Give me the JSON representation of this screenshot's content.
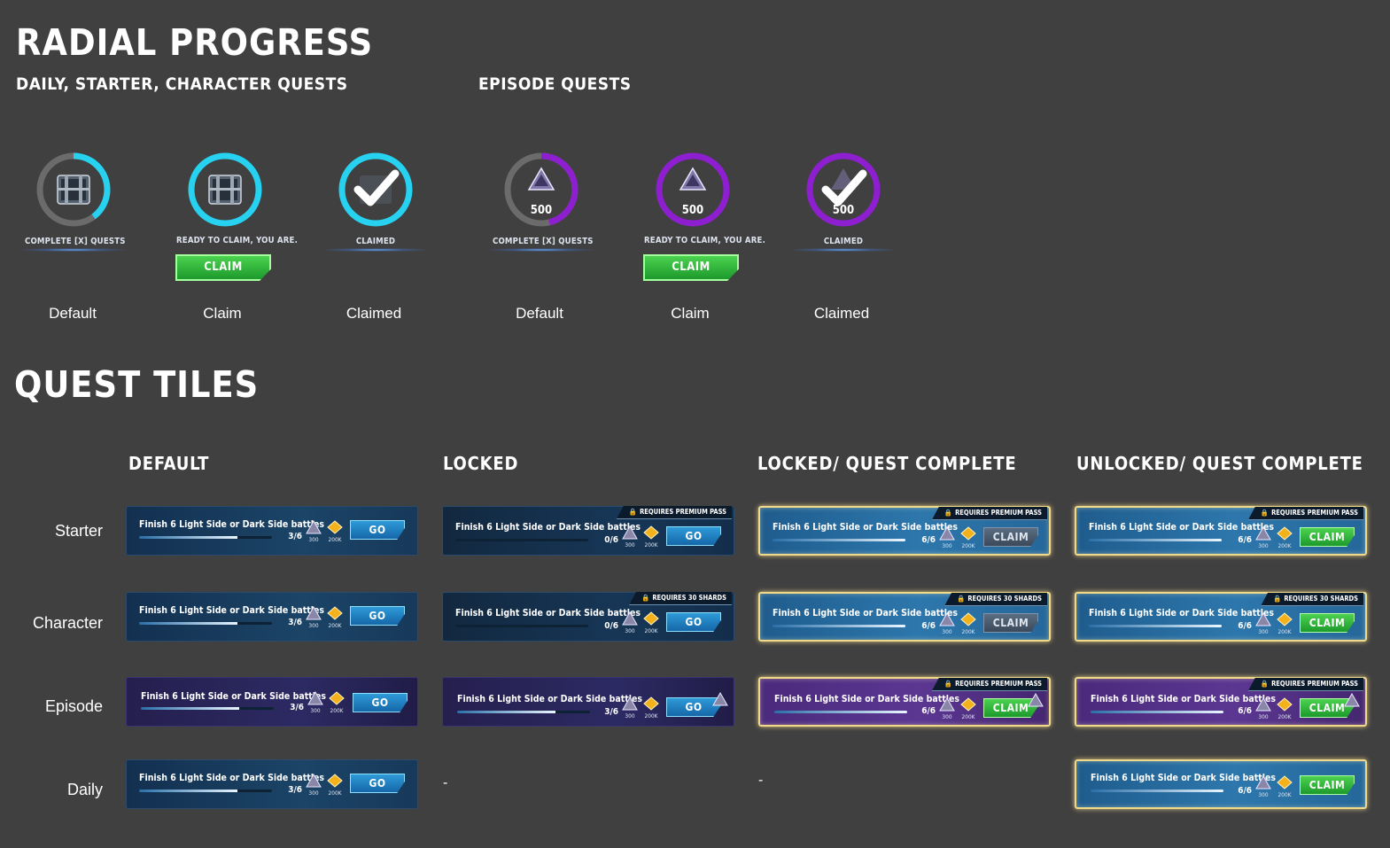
{
  "headings": {
    "radial_title": "RADIAL PROGRESS",
    "radial_left_sub": "DAILY, STARTER, CHARACTER QUESTS",
    "radial_right_sub": "EPISODE QUESTS",
    "tiles_title": "QUEST TILES",
    "col_default": "DEFAULT",
    "col_locked": "LOCKED",
    "col_locked_complete": "LOCKED/ QUEST COMPLETE",
    "col_unlocked_complete": "UNLOCKED/ QUEST COMPLETE"
  },
  "radials": [
    {
      "label": "COMPLETE [X] QUESTS",
      "caption": "Default",
      "number": "",
      "button": ""
    },
    {
      "label": "READY TO CLAIM, YOU ARE.",
      "caption": "Claim",
      "number": "",
      "button": "CLAIM"
    },
    {
      "label": "CLAIMED",
      "caption": "Claimed",
      "number": "",
      "button": ""
    },
    {
      "label": "COMPLETE [X] QUESTS",
      "caption": "Default",
      "number": "500",
      "button": ""
    },
    {
      "label": "READY TO CLAIM, YOU ARE.",
      "caption": "Claim",
      "number": "500",
      "button": "CLAIM"
    },
    {
      "label": "CLAIMED",
      "caption": "Claimed",
      "number": "500",
      "button": ""
    }
  ],
  "rows": [
    "Starter",
    "Character",
    "Episode",
    "Daily"
  ],
  "quest_text": "Finish 6 Light Side or Dark Side battles",
  "reward_amounts": [
    "300",
    "200K"
  ],
  "tabs": {
    "premium": "REQUIRES PREMIUM PASS",
    "shards": "REQUIRES 30 SHARDS"
  },
  "buttons": {
    "go": "GO",
    "claim": "CLAIM"
  },
  "counts": {
    "partial": "3/6",
    "zero": "0/6",
    "full": "6/6"
  },
  "dash": "-",
  "colors": {
    "background": "#404040",
    "cyan_ring": "#27d2f0",
    "purple_ring": "#8e1fd0",
    "claim_green": "#2bb33a",
    "go_blue": "#1d7fc0",
    "gold_border": "#f1d98a"
  }
}
